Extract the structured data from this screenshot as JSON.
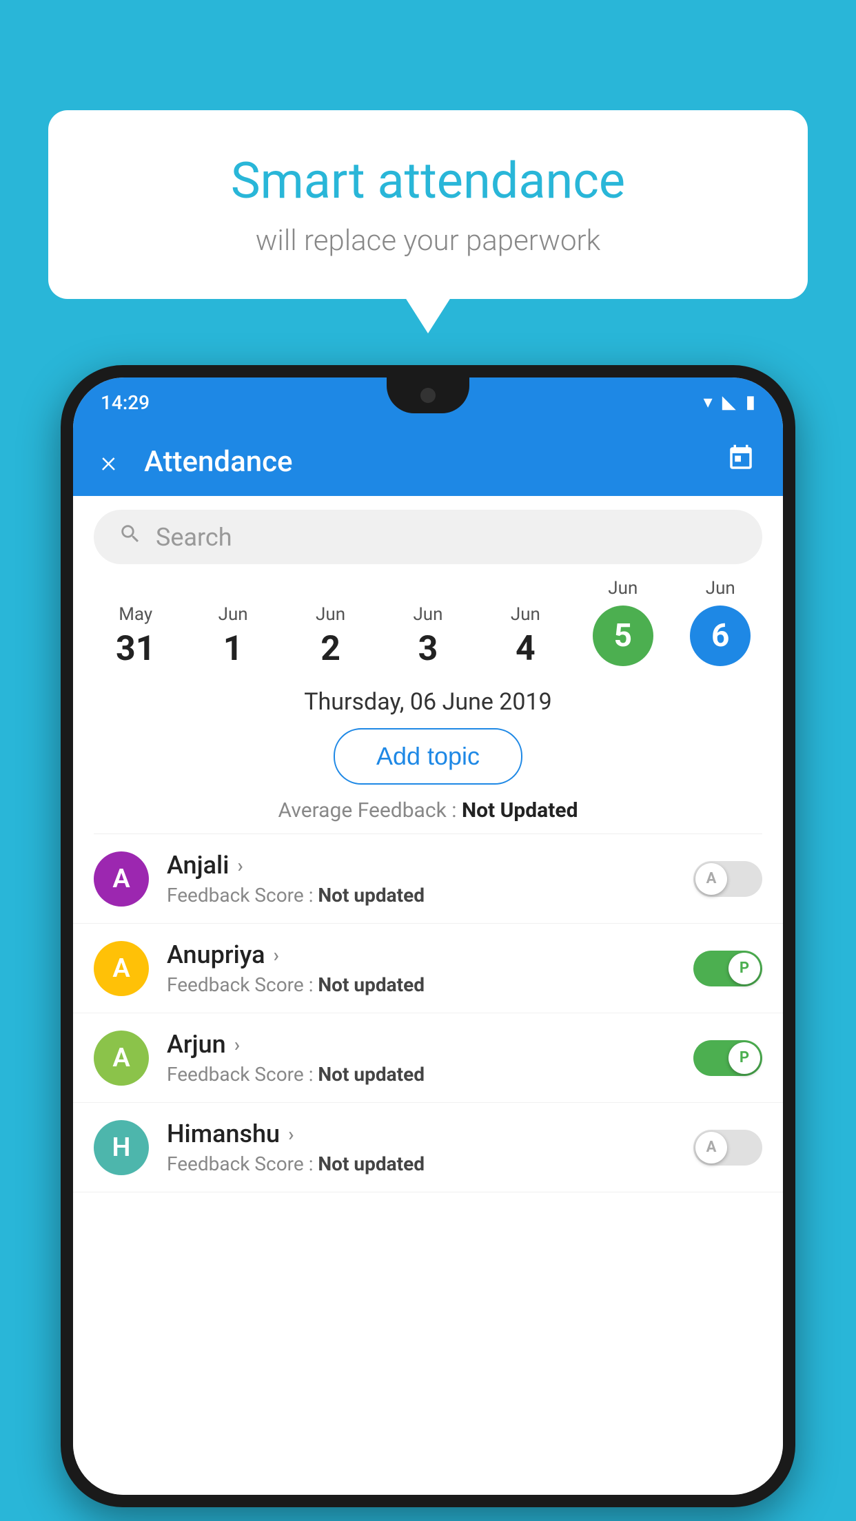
{
  "background_color": "#29B6D8",
  "speech_bubble": {
    "title": "Smart attendance",
    "subtitle": "will replace your paperwork"
  },
  "phone": {
    "status_bar": {
      "time": "14:29",
      "icons": [
        "wifi",
        "signal",
        "battery"
      ]
    },
    "app_bar": {
      "title": "Attendance",
      "close_label": "×",
      "calendar_icon": "📅"
    },
    "search": {
      "placeholder": "Search"
    },
    "calendar": {
      "days": [
        {
          "month": "May",
          "num": "31",
          "style": "plain"
        },
        {
          "month": "Jun",
          "num": "1",
          "style": "plain"
        },
        {
          "month": "Jun",
          "num": "2",
          "style": "plain"
        },
        {
          "month": "Jun",
          "num": "3",
          "style": "plain"
        },
        {
          "month": "Jun",
          "num": "4",
          "style": "plain"
        },
        {
          "month": "Jun",
          "num": "5",
          "style": "green"
        },
        {
          "month": "Jun",
          "num": "6",
          "style": "blue"
        }
      ]
    },
    "selected_date": "Thursday, 06 June 2019",
    "add_topic_label": "Add topic",
    "feedback_label": "Average Feedback : ",
    "feedback_value": "Not Updated",
    "students": [
      {
        "name": "Anjali",
        "avatar_letter": "A",
        "avatar_color": "purple",
        "feedback_label": "Feedback Score : ",
        "feedback_value": "Not updated",
        "toggle_state": "off",
        "toggle_letter": "A"
      },
      {
        "name": "Anupriya",
        "avatar_letter": "A",
        "avatar_color": "orange",
        "feedback_label": "Feedback Score : ",
        "feedback_value": "Not updated",
        "toggle_state": "on",
        "toggle_letter": "P"
      },
      {
        "name": "Arjun",
        "avatar_letter": "A",
        "avatar_color": "light-green",
        "feedback_label": "Feedback Score : ",
        "feedback_value": "Not updated",
        "toggle_state": "on",
        "toggle_letter": "P"
      },
      {
        "name": "Himanshu",
        "avatar_letter": "H",
        "avatar_color": "teal",
        "feedback_label": "Feedback Score : ",
        "feedback_value": "Not updated",
        "toggle_state": "off",
        "toggle_letter": "A"
      }
    ]
  }
}
